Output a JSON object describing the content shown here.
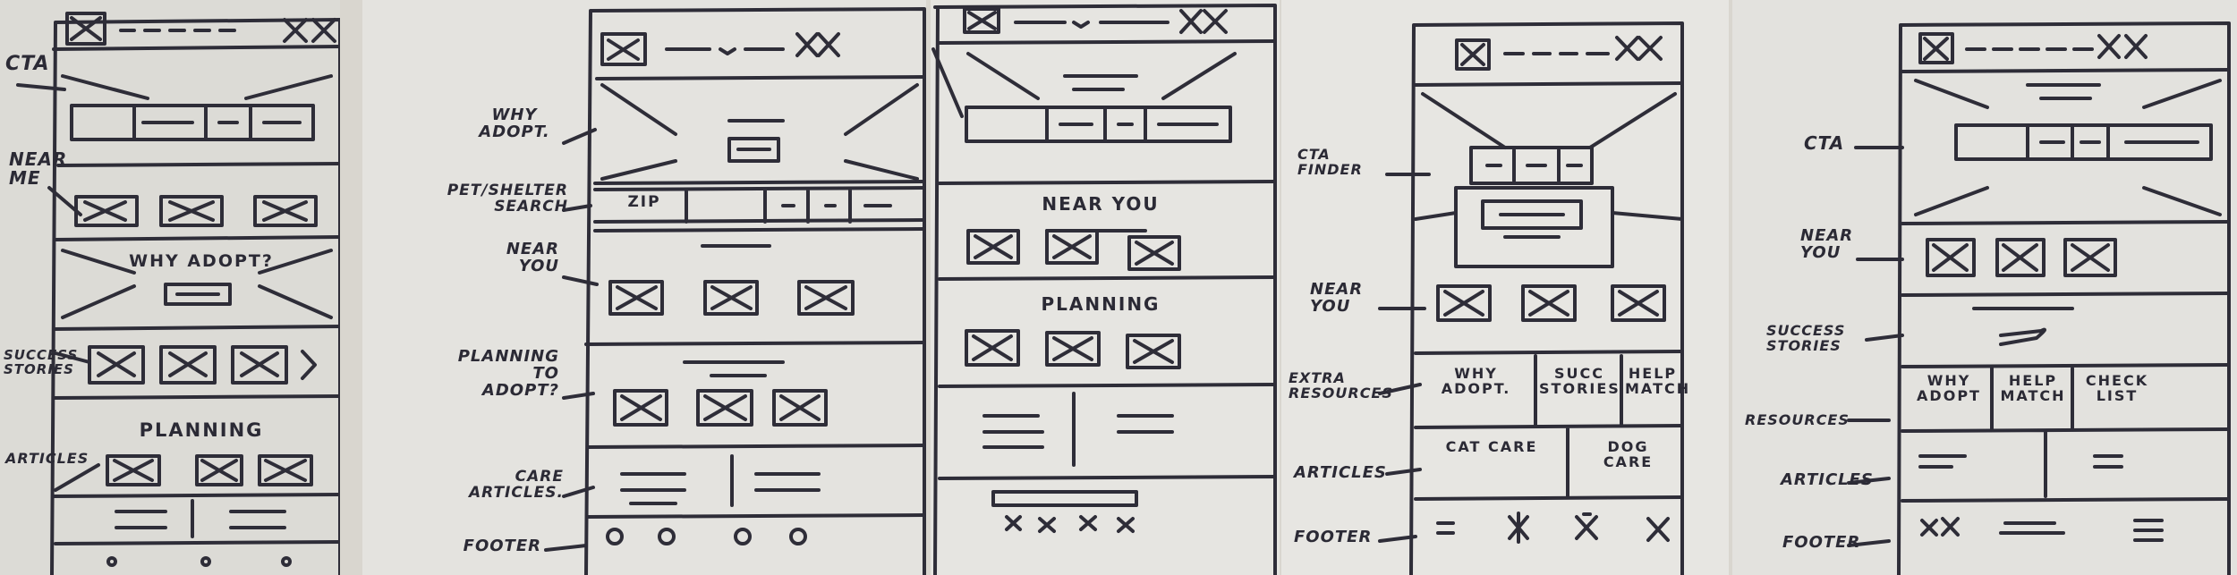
{
  "sketches": [
    {
      "annotations": {
        "cta": "CTA",
        "near_me": "NEAR ME",
        "success_stories": "SUCCESS STORIES",
        "articles": "ARTICLES"
      },
      "content": {
        "why_adopt": "WHY ADOPT?",
        "planning": "PLANNING"
      }
    },
    {
      "annotations": {
        "why_adopt": "WHY ADOPT.",
        "search": "PET/SHELTER SEARCH",
        "near_you": "NEAR YOU",
        "planning": "PLANNING TO ADOPT?",
        "care_articles": "CARE ARTICLES.",
        "footer": "FOOTER"
      },
      "content": {
        "zip": "ZIP"
      }
    },
    {
      "content": {
        "near_you": "NEAR YOU",
        "planning": "PLANNING"
      }
    },
    {
      "annotations": {
        "cta_finder": "CTA FINDER",
        "near_you": "NEAR YOU",
        "extra_resources": "EXTRA RESOURCES",
        "articles": "ARTICLES",
        "footer": "FOOTER"
      },
      "content": {
        "why_adopt": "WHY ADOPT.",
        "succ_stories": "SUCC STORIES",
        "help_match": "HELP MATCH",
        "cat_care": "CAT CARE",
        "dog_care": "DOG CARE"
      }
    },
    {
      "annotations": {
        "cta": "CTA",
        "near_you": "NEAR YOU",
        "success_stories": "SUCCESS STORIES",
        "resources": "RESOURCES",
        "articles": "ARTICLES",
        "footer": "FOOTER"
      },
      "content": {
        "why_adopt": "WHY ADOPT",
        "help_match": "HELP MATCH",
        "check_list": "CHECK LIST"
      }
    }
  ]
}
